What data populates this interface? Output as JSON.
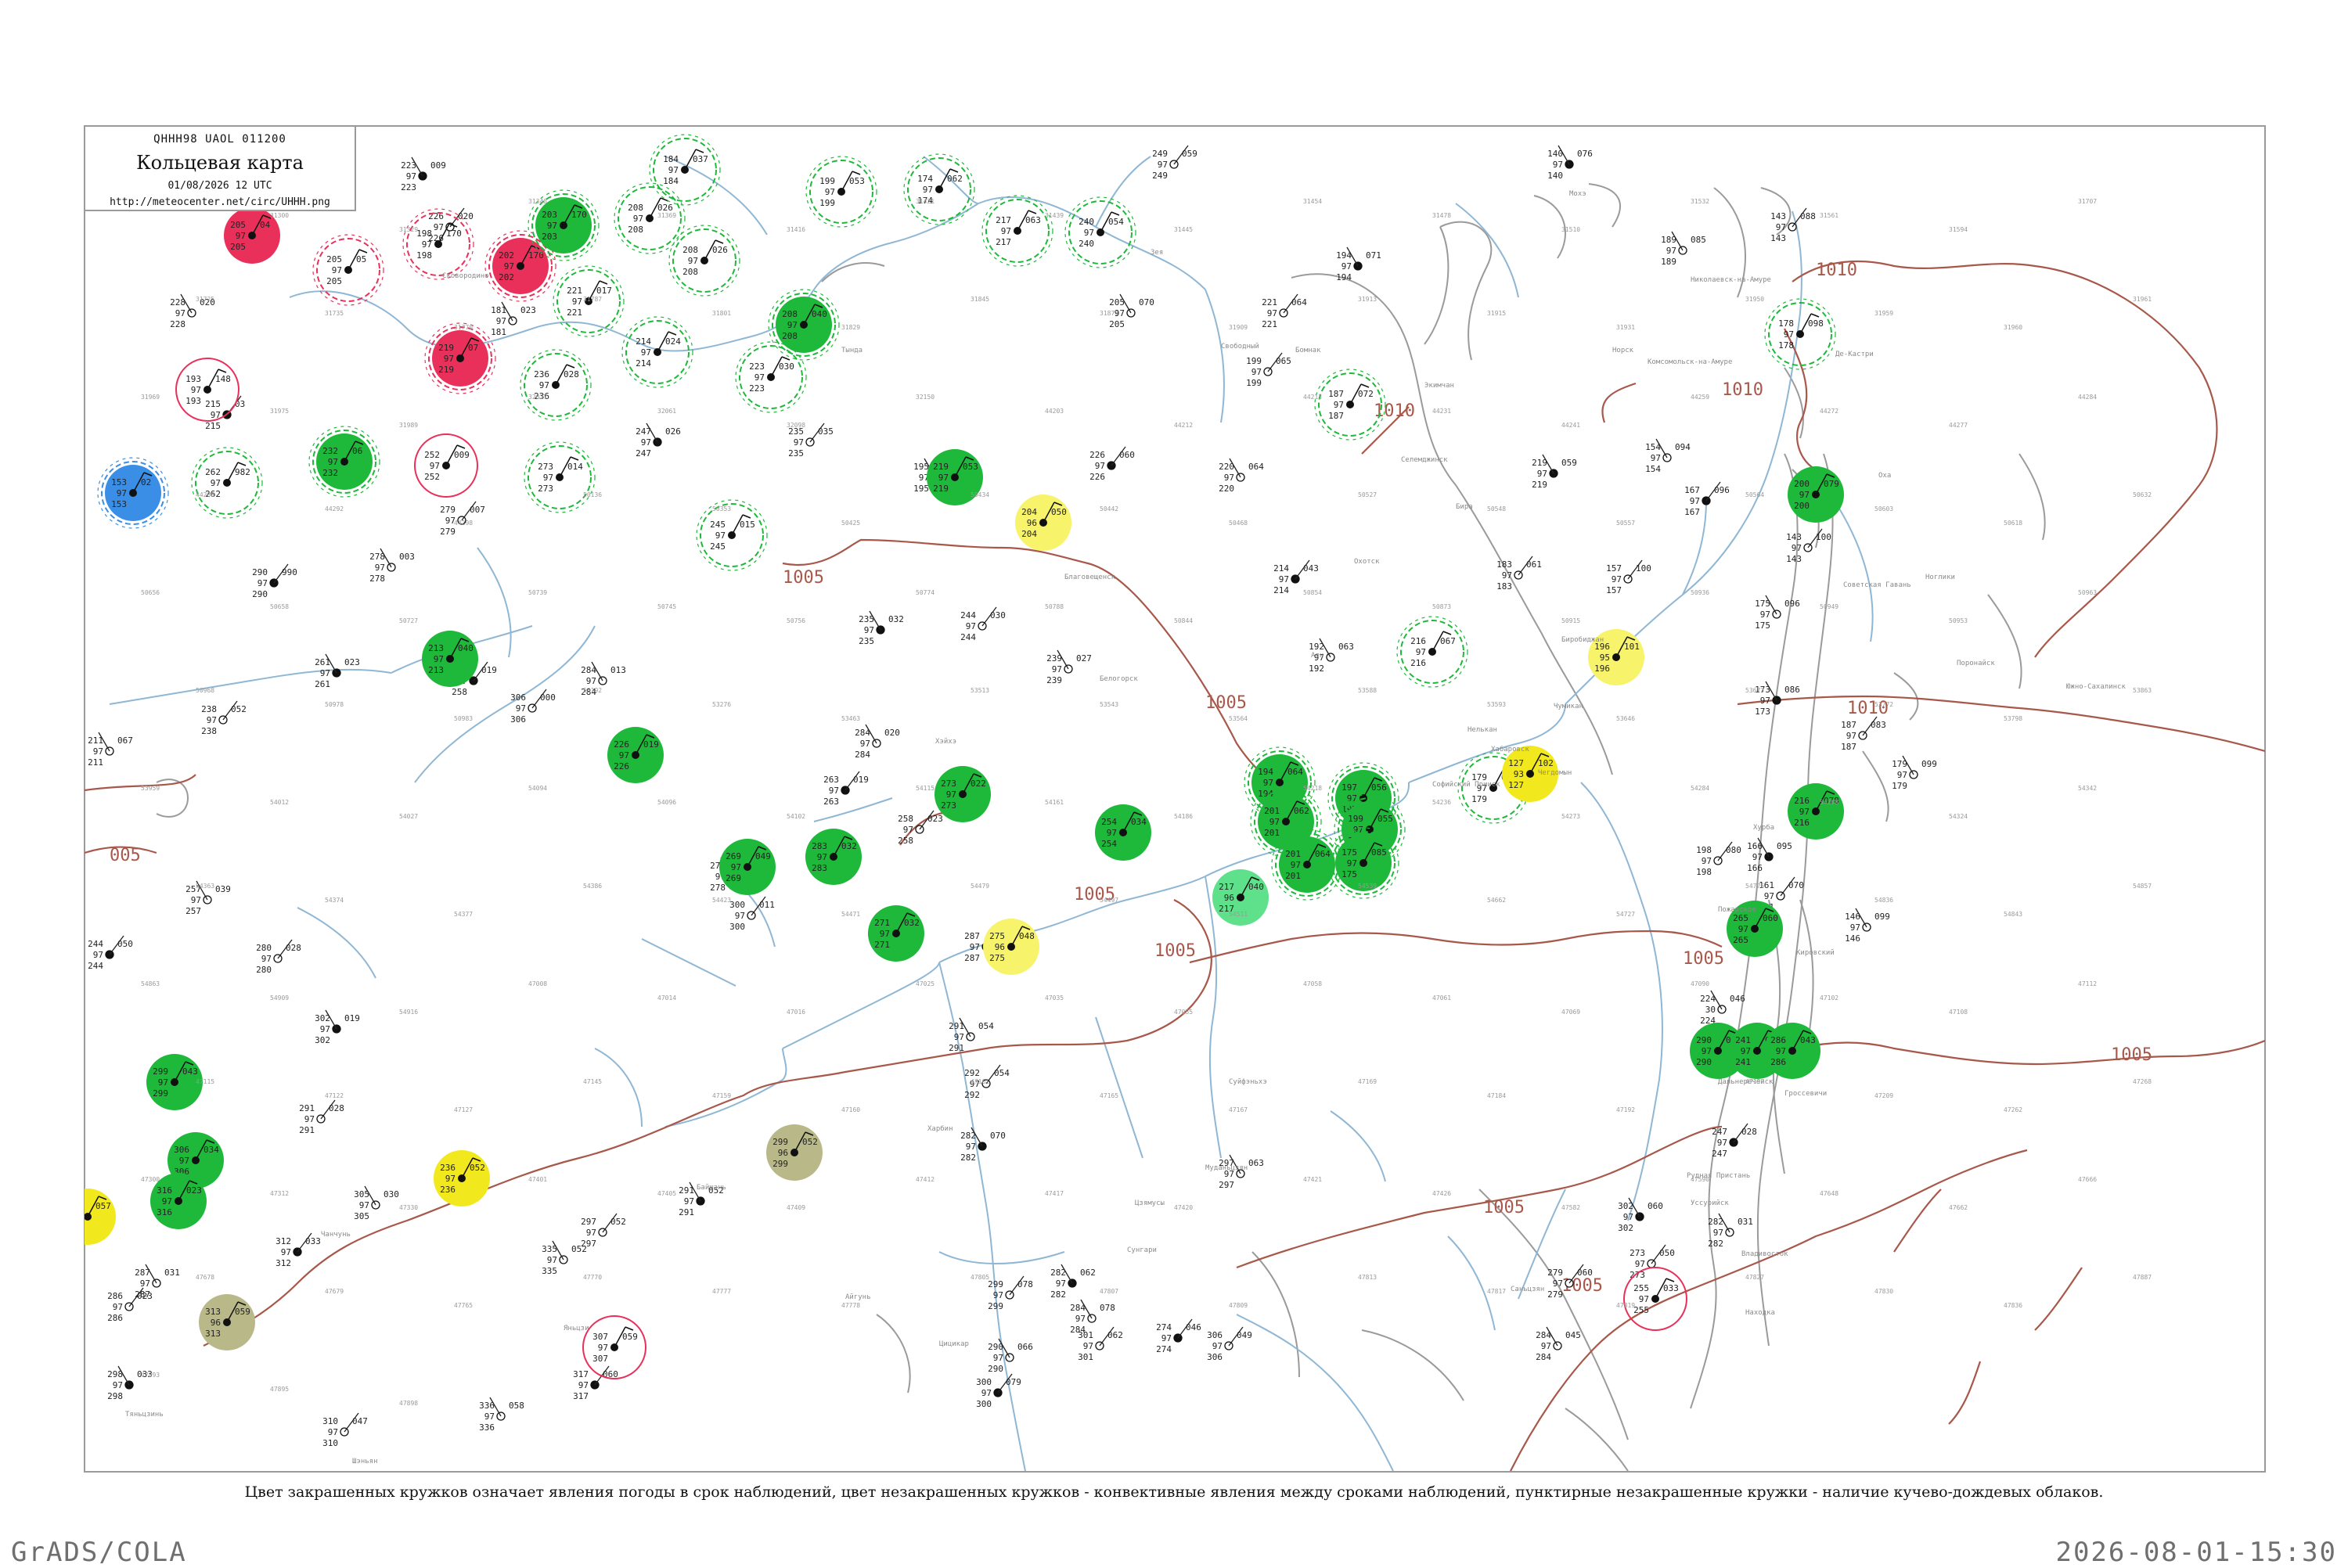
{
  "header": {
    "code": "QHHH98  UAOL  011200",
    "title": "Кольцевая карта",
    "date": "01/08/2026 12 UTC",
    "url": "http://meteocenter.net/circ/UHHH.png"
  },
  "caption": "Цвет закрашенных кружков означает явления погоды в срок наблюдений, цвет незакрашенных кружков - конвективные явления между сроками наблюдений, пунктирные незакрашенные кружки - наличие кучево-дождевых облаков.",
  "footer": {
    "left": "GrADS/COLA",
    "right": "2026-08-01-15:30"
  },
  "colors": {
    "isobar": "#a8584a",
    "river": "#8fb7d4",
    "coast": "#9a9a9a",
    "rain": "#1eb83a",
    "thunder": "#e8305a",
    "fog": "#f7f36a",
    "haze": "#f2e81e",
    "shower": "#5fe08a",
    "snow_mix": "#3a8ee6",
    "dust": "#b9b889",
    "cb_ring": "#3dbb4a"
  },
  "isobar_labels": [
    {
      "text": "1005"
    },
    {
      "text": "1005"
    },
    {
      "text": "1005"
    },
    {
      "text": "1005"
    },
    {
      "text": "1005"
    },
    {
      "text": "1005"
    },
    {
      "text": "1005"
    },
    {
      "text": "1005"
    },
    {
      "text": "1010"
    },
    {
      "text": "1010"
    },
    {
      "text": "1010"
    },
    {
      "text": "1010"
    },
    {
      "text": "005"
    }
  ],
  "stations": [
    {
      "id": "st-01",
      "fill": "thunder",
      "cb": false,
      "ring": "none",
      "p": "205",
      "t": "97",
      "d": "04"
    },
    {
      "id": "st-02",
      "fill": "none",
      "cb": true,
      "ring": "thunder",
      "p": "205",
      "t": "97",
      "d": "05"
    },
    {
      "id": "st-03",
      "fill": "none",
      "cb": true,
      "ring": "thunder",
      "p": "198",
      "t": "97",
      "d": "170"
    },
    {
      "id": "st-04",
      "fill": "thunder",
      "cb": true,
      "ring": "thunder",
      "p": "202",
      "t": "97",
      "d": "170"
    },
    {
      "id": "st-05",
      "fill": "rain",
      "cb": true,
      "ring": "rain",
      "p": "203",
      "t": "97",
      "d": "170"
    },
    {
      "id": "st-06",
      "fill": "thunder",
      "cb": true,
      "ring": "thunder",
      "p": "219",
      "t": "97",
      "d": "07"
    },
    {
      "id": "st-07",
      "fill": "none",
      "cb": false,
      "ring": "thunder",
      "p": "193",
      "t": "97",
      "d": "148"
    },
    {
      "id": "st-08",
      "fill": "snow_mix",
      "cb": true,
      "ring": "snow_mix",
      "p": "153",
      "t": "97",
      "d": "02"
    },
    {
      "id": "st-09",
      "fill": "rain",
      "cb": true,
      "ring": "rain",
      "p": "232",
      "t": "97",
      "d": "06"
    },
    {
      "id": "st-10",
      "fill": "none",
      "cb": true,
      "ring": "rain",
      "p": "262",
      "t": "97",
      "d": "982"
    },
    {
      "id": "st-11",
      "fill": "none",
      "cb": false,
      "ring": "thunder",
      "p": "252",
      "t": "97",
      "d": "009"
    },
    {
      "id": "st-12",
      "fill": "none",
      "cb": true,
      "ring": "rain",
      "p": "208",
      "t": "97",
      "d": "026"
    },
    {
      "id": "st-13",
      "fill": "none",
      "cb": true,
      "ring": "rain",
      "p": "184",
      "t": "97",
      "d": "037"
    },
    {
      "id": "st-14",
      "fill": "none",
      "cb": true,
      "ring": "rain",
      "p": "208",
      "t": "97",
      "d": "026"
    },
    {
      "id": "st-15",
      "fill": "none",
      "cb": true,
      "ring": "rain",
      "p": "221",
      "t": "97",
      "d": "017"
    },
    {
      "id": "st-16",
      "fill": "none",
      "cb": true,
      "ring": "rain",
      "p": "236",
      "t": "97",
      "d": "028"
    },
    {
      "id": "st-17",
      "fill": "none",
      "cb": true,
      "ring": "rain",
      "p": "214",
      "t": "97",
      "d": "024"
    },
    {
      "id": "st-18",
      "fill": "rain",
      "cb": true,
      "ring": "rain",
      "p": "208",
      "t": "97",
      "d": "040"
    },
    {
      "id": "st-19",
      "fill": "none",
      "cb": true,
      "ring": "rain",
      "p": "223",
      "t": "97",
      "d": "030"
    },
    {
      "id": "st-20",
      "fill": "none",
      "cb": true,
      "ring": "rain",
      "p": "199",
      "t": "97",
      "d": "053"
    },
    {
      "id": "st-21",
      "fill": "none",
      "cb": true,
      "ring": "rain",
      "p": "174",
      "t": "97",
      "d": "062"
    },
    {
      "id": "st-22",
      "fill": "none",
      "cb": true,
      "ring": "rain",
      "p": "217",
      "t": "97",
      "d": "063"
    },
    {
      "id": "st-23",
      "fill": "none",
      "cb": true,
      "ring": "rain",
      "p": "240",
      "t": "97",
      "d": "054"
    },
    {
      "id": "st-24",
      "fill": "none",
      "cb": true,
      "ring": "rain",
      "p": "273",
      "t": "97",
      "d": "014"
    },
    {
      "id": "st-25",
      "fill": "none",
      "cb": true,
      "ring": "rain",
      "p": "245",
      "t": "97",
      "d": "015"
    },
    {
      "id": "st-26",
      "fill": "rain",
      "cb": false,
      "ring": "none",
      "p": "219",
      "t": "97",
      "d": "053"
    },
    {
      "id": "st-27",
      "fill": "fog",
      "cb": false,
      "ring": "none",
      "p": "204",
      "t": "96",
      "d": "050"
    },
    {
      "id": "st-28",
      "fill": "none",
      "cb": true,
      "ring": "rain",
      "p": "187",
      "t": "97",
      "d": "072"
    },
    {
      "id": "st-29",
      "fill": "none",
      "cb": true,
      "ring": "rain",
      "p": "216",
      "t": "97",
      "d": "067"
    },
    {
      "id": "st-30",
      "fill": "fog",
      "cb": false,
      "ring": "none",
      "p": "196",
      "t": "95",
      "d": "101"
    },
    {
      "id": "st-31",
      "fill": "rain",
      "cb": false,
      "ring": "none",
      "p": "213",
      "t": "97",
      "d": "040"
    },
    {
      "id": "st-32",
      "fill": "rain",
      "cb": false,
      "ring": "none",
      "p": "226",
      "t": "97",
      "d": "019"
    },
    {
      "id": "st-33",
      "fill": "rain",
      "cb": false,
      "ring": "none",
      "p": "273",
      "t": "97",
      "d": "022"
    },
    {
      "id": "st-34",
      "fill": "rain",
      "cb": false,
      "ring": "none",
      "p": "269",
      "t": "97",
      "d": "049"
    },
    {
      "id": "st-35",
      "fill": "rain",
      "cb": false,
      "ring": "none",
      "p": "283",
      "t": "97",
      "d": "032"
    },
    {
      "id": "st-36",
      "fill": "rain",
      "cb": false,
      "ring": "none",
      "p": "254",
      "t": "97",
      "d": "034"
    },
    {
      "id": "st-37",
      "fill": "rain",
      "cb": false,
      "ring": "none",
      "p": "271",
      "t": "97",
      "d": "032"
    },
    {
      "id": "st-38",
      "fill": "fog",
      "cb": false,
      "ring": "none",
      "p": "275",
      "t": "96",
      "d": "048"
    },
    {
      "id": "st-39",
      "fill": "shower",
      "cb": false,
      "ring": "none",
      "p": "217",
      "t": "96",
      "d": "040"
    },
    {
      "id": "st-40",
      "fill": "rain",
      "cb": true,
      "ring": "rain",
      "p": "194",
      "t": "97",
      "d": "064"
    },
    {
      "id": "st-41",
      "fill": "rain",
      "cb": true,
      "ring": "rain",
      "p": "197",
      "t": "97",
      "d": "056"
    },
    {
      "id": "st-42",
      "fill": "rain",
      "cb": true,
      "ring": "rain",
      "p": "201",
      "t": "97",
      "d": "062"
    },
    {
      "id": "st-43",
      "fill": "rain",
      "cb": true,
      "ring": "rain",
      "p": "199",
      "t": "97",
      "d": "055"
    },
    {
      "id": "st-44",
      "fill": "rain",
      "cb": true,
      "ring": "rain",
      "p": "201",
      "t": "97",
      "d": "064"
    },
    {
      "id": "st-45",
      "fill": "rain",
      "cb": true,
      "ring": "rain",
      "p": "175",
      "t": "97",
      "d": "085"
    },
    {
      "id": "st-46",
      "fill": "none",
      "cb": true,
      "ring": "rain",
      "p": "179",
      "t": "97",
      "d": "094"
    },
    {
      "id": "st-47",
      "fill": "haze",
      "cb": false,
      "ring": "none",
      "p": "127",
      "t": "93",
      "d": "102"
    },
    {
      "id": "st-48",
      "fill": "none",
      "cb": true,
      "ring": "rain",
      "p": "178",
      "t": "97",
      "d": "098"
    },
    {
      "id": "st-49",
      "fill": "rain",
      "cb": false,
      "ring": "none",
      "p": "200",
      "t": "97",
      "d": "079"
    },
    {
      "id": "st-50",
      "fill": "rain",
      "cb": false,
      "ring": "none",
      "p": "216",
      "t": "97",
      "d": "078"
    },
    {
      "id": "st-51",
      "fill": "rain",
      "cb": false,
      "ring": "none",
      "p": "265",
      "t": "97",
      "d": "060"
    },
    {
      "id": "st-52",
      "fill": "rain",
      "cb": false,
      "ring": "none",
      "p": "290",
      "t": "97",
      "d": "041"
    },
    {
      "id": "st-53",
      "fill": "rain",
      "cb": false,
      "ring": "none",
      "p": "241",
      "t": "97",
      "d": "069"
    },
    {
      "id": "st-54",
      "fill": "rain",
      "cb": false,
      "ring": "none",
      "p": "286",
      "t": "97",
      "d": "043"
    },
    {
      "id": "st-55",
      "fill": "rain",
      "cb": false,
      "ring": "none",
      "p": "299",
      "t": "97",
      "d": "043"
    },
    {
      "id": "st-56",
      "fill": "rain",
      "cb": false,
      "ring": "none",
      "p": "306",
      "t": "97",
      "d": "034"
    },
    {
      "id": "st-57",
      "fill": "rain",
      "cb": false,
      "ring": "none",
      "p": "316",
      "t": "97",
      "d": "023"
    },
    {
      "id": "st-58",
      "fill": "haze",
      "cb": false,
      "ring": "none",
      "p": "207",
      "t": "97",
      "d": "057"
    },
    {
      "id": "st-59",
      "fill": "haze",
      "cb": false,
      "ring": "none",
      "p": "236",
      "t": "97",
      "d": "052"
    },
    {
      "id": "st-60",
      "fill": "dust",
      "cb": false,
      "ring": "none",
      "p": "299",
      "t": "96",
      "d": "052"
    },
    {
      "id": "st-61",
      "fill": "dust",
      "cb": false,
      "ring": "none",
      "p": "313",
      "t": "96",
      "d": "059"
    },
    {
      "id": "st-62",
      "fill": "none",
      "cb": false,
      "ring": "thunder",
      "p": "307",
      "t": "97",
      "d": "059"
    },
    {
      "id": "st-63",
      "fill": "none",
      "cb": false,
      "ring": "thunder",
      "p": "255",
      "t": "97",
      "d": "033"
    }
  ],
  "plain_obs": [
    {
      "p": "223",
      "t": "97",
      "d": "009"
    },
    {
      "p": "226",
      "t": "97",
      "d": "020"
    },
    {
      "p": "228",
      "t": "97",
      "d": "020"
    },
    {
      "p": "215",
      "t": "97",
      "d": "03"
    },
    {
      "p": "181",
      "t": "97",
      "d": "023"
    },
    {
      "p": "249",
      "t": "97",
      "d": "059"
    },
    {
      "p": "140",
      "t": "97",
      "d": "076"
    },
    {
      "p": "143",
      "t": "97",
      "d": "088"
    },
    {
      "p": "189",
      "t": "97",
      "d": "085"
    },
    {
      "p": "290",
      "t": "97",
      "d": "990"
    },
    {
      "p": "278",
      "t": "97",
      "d": "003"
    },
    {
      "p": "279",
      "t": "97",
      "d": "007"
    },
    {
      "p": "261",
      "t": "97",
      "d": "023"
    },
    {
      "p": "238",
      "t": "97",
      "d": "052"
    },
    {
      "p": "211",
      "t": "97",
      "d": "067"
    },
    {
      "p": "258",
      "t": "97",
      "d": "019"
    },
    {
      "p": "284",
      "t": "97",
      "d": "013"
    },
    {
      "p": "306",
      "t": "97",
      "d": "000"
    },
    {
      "p": "247",
      "t": "97",
      "d": "026"
    },
    {
      "p": "235",
      "t": "97",
      "d": "035"
    },
    {
      "p": "195",
      "t": "97",
      "d": "062"
    },
    {
      "p": "226",
      "t": "97",
      "d": "060"
    },
    {
      "p": "205",
      "t": "97",
      "d": "070"
    },
    {
      "p": "221",
      "t": "97",
      "d": "064"
    },
    {
      "p": "194",
      "t": "97",
      "d": "071"
    },
    {
      "p": "199",
      "t": "97",
      "d": "065"
    },
    {
      "p": "220",
      "t": "97",
      "d": "064"
    },
    {
      "p": "214",
      "t": "97",
      "d": "043"
    },
    {
      "p": "192",
      "t": "97",
      "d": "063"
    },
    {
      "p": "183",
      "t": "97",
      "d": "061"
    },
    {
      "p": "219",
      "t": "97",
      "d": "059"
    },
    {
      "p": "157",
      "t": "97",
      "d": "100"
    },
    {
      "p": "154",
      "t": "97",
      "d": "094"
    },
    {
      "p": "167",
      "t": "97",
      "d": "096"
    },
    {
      "p": "175",
      "t": "97",
      "d": "096"
    },
    {
      "p": "143",
      "t": "97",
      "d": "100"
    },
    {
      "p": "173",
      "t": "97",
      "d": "086"
    },
    {
      "p": "187",
      "t": "97",
      "d": "083"
    },
    {
      "p": "179",
      "t": "97",
      "d": "099"
    },
    {
      "p": "244",
      "t": "97",
      "d": "050"
    },
    {
      "p": "257",
      "t": "97",
      "d": "039"
    },
    {
      "p": "280",
      "t": "97",
      "d": "028"
    },
    {
      "p": "302",
      "t": "97",
      "d": "019"
    },
    {
      "p": "291",
      "t": "97",
      "d": "028"
    },
    {
      "p": "305",
      "t": "97",
      "d": "030"
    },
    {
      "p": "312",
      "t": "97",
      "d": "033"
    },
    {
      "p": "287",
      "t": "97",
      "d": "031"
    },
    {
      "p": "286",
      "t": "97",
      "d": "023"
    },
    {
      "p": "298",
      "t": "97",
      "d": "033"
    },
    {
      "p": "310",
      "t": "97",
      "d": "047"
    },
    {
      "p": "336",
      "t": "97",
      "d": "058"
    },
    {
      "p": "317",
      "t": "97",
      "d": "060"
    },
    {
      "p": "335",
      "t": "97",
      "d": "052"
    },
    {
      "p": "297",
      "t": "97",
      "d": "052"
    },
    {
      "p": "291",
      "t": "97",
      "d": "052"
    },
    {
      "p": "300",
      "t": "97",
      "d": "011"
    },
    {
      "p": "278",
      "t": "97",
      "d": "016"
    },
    {
      "p": "263",
      "t": "97",
      "d": "019"
    },
    {
      "p": "284",
      "t": "97",
      "d": "020"
    },
    {
      "p": "258",
      "t": "97",
      "d": "023"
    },
    {
      "p": "235",
      "t": "97",
      "d": "032"
    },
    {
      "p": "244",
      "t": "97",
      "d": "030"
    },
    {
      "p": "239",
      "t": "97",
      "d": "027"
    },
    {
      "p": "287",
      "t": "97",
      "d": "071"
    },
    {
      "p": "291",
      "t": "97",
      "d": "054"
    },
    {
      "p": "292",
      "t": "97",
      "d": "054"
    },
    {
      "p": "282",
      "t": "97",
      "d": "070"
    },
    {
      "p": "299",
      "t": "97",
      "d": "078"
    },
    {
      "p": "290",
      "t": "97",
      "d": "066"
    },
    {
      "p": "300",
      "t": "97",
      "d": "079"
    },
    {
      "p": "284",
      "t": "97",
      "d": "078"
    },
    {
      "p": "301",
      "t": "97",
      "d": "062"
    },
    {
      "p": "282",
      "t": "97",
      "d": "062"
    },
    {
      "p": "306",
      "t": "97",
      "d": "049"
    },
    {
      "p": "297",
      "t": "97",
      "d": "063"
    },
    {
      "p": "274",
      "t": "97",
      "d": "046"
    },
    {
      "p": "284",
      "t": "97",
      "d": "045"
    },
    {
      "p": "279",
      "t": "97",
      "d": "060"
    },
    {
      "p": "302",
      "t": "97",
      "d": "060"
    },
    {
      "p": "273",
      "t": "97",
      "d": "050"
    },
    {
      "p": "282",
      "t": "97",
      "d": "031"
    },
    {
      "p": "247",
      "t": "97",
      "d": "028"
    },
    {
      "p": "224",
      "t": "30",
      "d": "046"
    },
    {
      "p": "198",
      "t": "97",
      "d": "080"
    },
    {
      "p": "166",
      "t": "97",
      "d": "095"
    },
    {
      "p": "161",
      "t": "97",
      "d": "070"
    },
    {
      "p": "146",
      "t": "97",
      "d": "099"
    }
  ],
  "place_labels": [
    "Мохэ",
    "Сковородино",
    "Тында",
    "Зея",
    "Свободный",
    "Благовещенск",
    "Белогорск",
    "Хэйхэ",
    "Бомнак",
    "Экимчан",
    "Норск",
    "Селемджинск",
    "Бира",
    "Биробиджан",
    "Хабаровск",
    "Комсомольск-на-Амуре",
    "Николаевск-на-Амуре",
    "Де-Кастри",
    "Советская Гавань",
    "Южно-Сахалинск",
    "Оха",
    "Ноглики",
    "Поронайск",
    "Владивосток",
    "Уссурийск",
    "Находка",
    "Дальнереченск",
    "Кировский",
    "Рудная Пристань",
    "Пожарское",
    "Чумикан",
    "Аян",
    "Охотск",
    "Нелькан",
    "Чегдомын",
    "Софийский Прииск",
    "Хурба",
    "Гроссевичи",
    "Саньцзян",
    "Цзямусы",
    "Харбин",
    "Муданьцзян",
    "Суйфэньхэ",
    "Сунгари",
    "Цицикар",
    "Айгунь",
    "Байшань",
    "Яньцзи",
    "Чанчунь",
    "Тяньцзинь",
    "Шэньян",
    "Далянь"
  ],
  "station_ids": [
    "31253",
    "31300",
    "31329",
    "31348",
    "31369",
    "31416",
    "31421",
    "31439",
    "31445",
    "31454",
    "31478",
    "31510",
    "31532",
    "31561",
    "31594",
    "31707",
    "31725",
    "31735",
    "31770",
    "31787",
    "31801",
    "31829",
    "31845",
    "31873",
    "31909",
    "31913",
    "31915",
    "31931",
    "31950",
    "31959",
    "31960",
    "31961",
    "31969",
    "31975",
    "31989",
    "32027",
    "32061",
    "32098",
    "32150",
    "44203",
    "44212",
    "44213",
    "44231",
    "44241",
    "44259",
    "44272",
    "44277",
    "44284",
    "44288",
    "44292",
    "44298",
    "50136",
    "50353",
    "50425",
    "50434",
    "50442",
    "50468",
    "50527",
    "50548",
    "50557",
    "50564",
    "50603",
    "50618",
    "50632",
    "50656",
    "50658",
    "50727",
    "50739",
    "50745",
    "50756",
    "50774",
    "50788",
    "50844",
    "50854",
    "50873",
    "50915",
    "50936",
    "50949",
    "50953",
    "50963",
    "50968",
    "50978",
    "50983",
    "53192",
    "53276",
    "53463",
    "53513",
    "53543",
    "53564",
    "53588",
    "53593",
    "53646",
    "53673",
    "53772",
    "53798",
    "53863",
    "53959",
    "54012",
    "54027",
    "54094",
    "54096",
    "54102",
    "54115",
    "54161",
    "54186",
    "54218",
    "54236",
    "54273",
    "54284",
    "54308",
    "54324",
    "54342",
    "54363",
    "54374",
    "54377",
    "54386",
    "54423",
    "54471",
    "54479",
    "54497",
    "54511",
    "54539",
    "54662",
    "54727",
    "54776",
    "54836",
    "54843",
    "54857",
    "54863",
    "54909",
    "54916",
    "47008",
    "47014",
    "47016",
    "47025",
    "47035",
    "47055",
    "47058",
    "47061",
    "47069",
    "47090",
    "47102",
    "47108",
    "47112",
    "47115",
    "47122",
    "47127",
    "47145",
    "47159",
    "47160",
    "47161",
    "47165",
    "47167",
    "47169",
    "47184",
    "47192",
    "47197",
    "47209",
    "47262",
    "47268",
    "47300",
    "47312",
    "47330",
    "47401",
    "47405",
    "47409",
    "47412",
    "47417",
    "47420",
    "47421",
    "47426",
    "47582",
    "47590",
    "47648",
    "47662",
    "47666",
    "47678",
    "47679",
    "47765",
    "47770",
    "47777",
    "47778",
    "47805",
    "47807",
    "47809",
    "47813",
    "47817",
    "47819",
    "47827",
    "47830",
    "47836",
    "47887",
    "47893",
    "47895",
    "47898"
  ]
}
